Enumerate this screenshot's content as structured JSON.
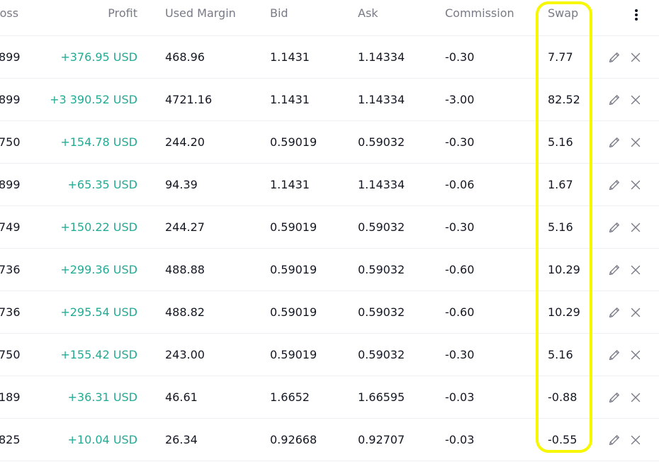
{
  "columns": {
    "loss": "Loss",
    "profit": "Profit",
    "used_margin": "Used Margin",
    "bid": "Bid",
    "ask": "Ask",
    "commission": "Commission",
    "swap": "Swap"
  },
  "icons": {
    "more": "more-vertical-icon",
    "edit": "pencil-icon",
    "close": "close-icon"
  },
  "colors": {
    "profit_positive": "#22ab94",
    "highlight": "#f7f700",
    "header_text": "#787b86"
  },
  "rows": [
    {
      "loss": "899",
      "profit": "+376.95 USD",
      "used_margin": "468.96",
      "bid": "1.1431",
      "ask": "1.14334",
      "commission": "-0.30",
      "swap": "7.77"
    },
    {
      "loss": "899",
      "profit": "+3 390.52 USD",
      "used_margin": "4721.16",
      "bid": "1.1431",
      "ask": "1.14334",
      "commission": "-3.00",
      "swap": "82.52"
    },
    {
      "loss": "750",
      "profit": "+154.78 USD",
      "used_margin": "244.20",
      "bid": "0.59019",
      "ask": "0.59032",
      "commission": "-0.30",
      "swap": "5.16"
    },
    {
      "loss": "899",
      "profit": "+65.35 USD",
      "used_margin": "94.39",
      "bid": "1.1431",
      "ask": "1.14334",
      "commission": "-0.06",
      "swap": "1.67"
    },
    {
      "loss": "749",
      "profit": "+150.22 USD",
      "used_margin": "244.27",
      "bid": "0.59019",
      "ask": "0.59032",
      "commission": "-0.30",
      "swap": "5.16"
    },
    {
      "loss": "736",
      "profit": "+299.36 USD",
      "used_margin": "488.88",
      "bid": "0.59019",
      "ask": "0.59032",
      "commission": "-0.60",
      "swap": "10.29"
    },
    {
      "loss": "736",
      "profit": "+295.54 USD",
      "used_margin": "488.82",
      "bid": "0.59019",
      "ask": "0.59032",
      "commission": "-0.60",
      "swap": "10.29"
    },
    {
      "loss": "750",
      "profit": "+155.42 USD",
      "used_margin": "243.00",
      "bid": "0.59019",
      "ask": "0.59032",
      "commission": "-0.30",
      "swap": "5.16"
    },
    {
      "loss": "189",
      "profit": "+36.31 USD",
      "used_margin": "46.61",
      "bid": "1.6652",
      "ask": "1.66595",
      "commission": "-0.03",
      "swap": "-0.88"
    },
    {
      "loss": "825",
      "profit": "+10.04 USD",
      "used_margin": "26.34",
      "bid": "0.92668",
      "ask": "0.92707",
      "commission": "-0.03",
      "swap": "-0.55"
    }
  ]
}
